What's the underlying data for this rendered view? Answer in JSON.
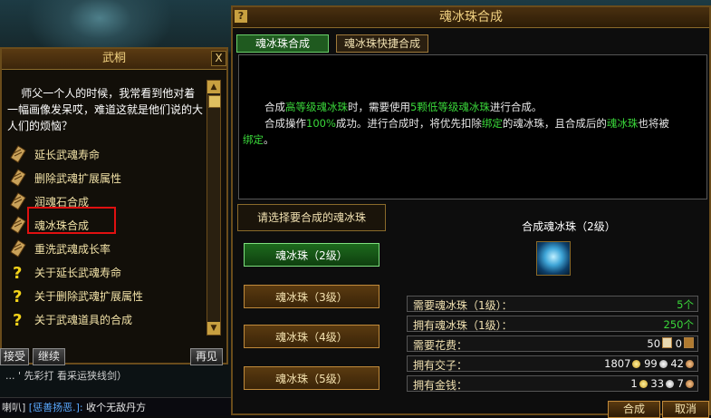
{
  "scene": {
    "chat_line1": "...  '  先彩打 看采运狭线剑）",
    "chat": {
      "channel": "喇叭]",
      "speaker": "[惩善扬恶.]:",
      "message": "收个无敌丹方"
    }
  },
  "npc_dialog": {
    "title": "武桐",
    "close_label": "X",
    "text": "    师父一个人的时候，我常看到他对着一幅画像发呆哎，难道这就是他们说的大人们的烦恼？",
    "options": [
      {
        "label": "延长武魂寿命",
        "icon": "scroll-icon"
      },
      {
        "label": "删除武魂扩展属性",
        "icon": "scroll-icon"
      },
      {
        "label": "润魂石合成",
        "icon": "scroll-icon"
      },
      {
        "label": "魂冰珠合成",
        "icon": "scroll-icon"
      },
      {
        "label": "重洗武魂成长率",
        "icon": "scroll-icon"
      },
      {
        "label": "关于延长武魂寿命",
        "icon": "question-icon"
      },
      {
        "label": "关于删除武魂扩展属性",
        "icon": "question-icon"
      },
      {
        "label": "关于武魂道具的合成",
        "icon": "question-icon"
      }
    ],
    "accept_label": "接受",
    "continue_label": "继续",
    "back_label": "再见",
    "scroll_up": "▲",
    "scroll_down": "▼"
  },
  "synth_window": {
    "title": "魂冰珠合成",
    "help_label": "?",
    "tabs": [
      {
        "label": "魂冰珠合成",
        "active": true
      },
      {
        "label": "魂冰珠快捷合成",
        "active": false
      }
    ],
    "desc": {
      "l1_a": "合成",
      "l1_b": "高等级魂冰珠",
      "l1_c": "时，需要使用",
      "l1_d": "5颗低等级魂冰珠",
      "l1_e": "进行合成。",
      "l2_a": "合成操作",
      "l2_b": "100%",
      "l2_c": "成功。进行合成时，将优先扣除",
      "l2_d": "绑定",
      "l2_e": "的魂冰珠，且合成后的",
      "l2_f": "魂冰珠",
      "l2_g": "也将被",
      "l3_a": "绑定",
      "l3_b": "。"
    },
    "select_header": "请选择要合成的魂冰珠",
    "pearls": [
      {
        "label": "魂冰珠（2级）",
        "selected": true
      },
      {
        "label": "魂冰珠（3级）",
        "selected": false
      },
      {
        "label": "魂冰珠（4级）",
        "selected": false
      },
      {
        "label": "魂冰珠（5级）",
        "selected": false
      }
    ],
    "result_label": "合成魂冰珠（2级）",
    "result_icon": "ice-pearl-icon",
    "req_rows": [
      {
        "label": "需要魂冰珠（1级）：",
        "value": "5个"
      },
      {
        "label": "拥有魂冰珠（1级）：",
        "value": "250个"
      }
    ],
    "cost": {
      "label": "需要花费：",
      "v1": "50",
      "v2": "0"
    },
    "jiaozi": {
      "label": "拥有交子：",
      "v1": "1807",
      "v2": "99",
      "v3": "42"
    },
    "money": {
      "label": "拥有金钱：",
      "v1": "1",
      "v2": "33",
      "v3": "7"
    },
    "combine_label": "合成",
    "cancel_label": "取消"
  },
  "colors": {
    "accent_green": "#3ad83a",
    "gold_text": "#f0d080",
    "highlight_red": "#e01010"
  }
}
